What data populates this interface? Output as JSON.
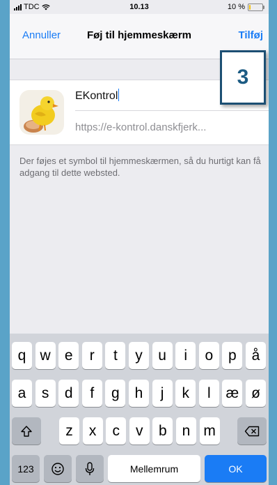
{
  "status_bar": {
    "carrier": "TDC",
    "time": "10.13",
    "battery": "10 %",
    "battery_level": 0.1,
    "battery_color": "#f4c20d"
  },
  "nav": {
    "cancel_label": "Annuller",
    "title": "Føj til hjemmeskærm",
    "add_label": "Tilføj"
  },
  "step_badge": "3",
  "form": {
    "name_value": "EKontrol",
    "url_value": "https://e-kontrol.danskfjerk...",
    "app_icon": "chick-icon"
  },
  "info_text": "Der føjes et symbol til hjemmeskærmen, så du hurtigt kan få adgang til dette websted.",
  "keyboard": {
    "row1": [
      "q",
      "w",
      "e",
      "r",
      "t",
      "y",
      "u",
      "i",
      "o",
      "p",
      "å"
    ],
    "row2": [
      "a",
      "s",
      "d",
      "f",
      "g",
      "h",
      "j",
      "k",
      "l",
      "æ",
      "ø"
    ],
    "row3": [
      "z",
      "x",
      "c",
      "v",
      "b",
      "n",
      "m"
    ],
    "numbers_label": "123",
    "space_label": "Mellemrum",
    "return_label": "OK",
    "accent_color": "#1a7cf5"
  }
}
